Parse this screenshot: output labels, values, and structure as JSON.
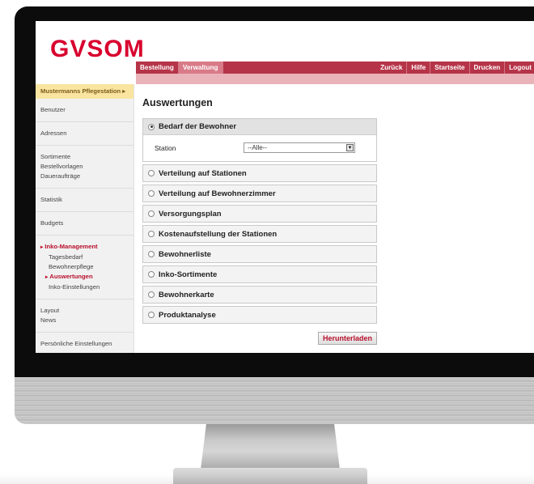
{
  "logo": {
    "text": "GVSOM",
    "color": "#d8002e"
  },
  "nav": {
    "left": [
      "Bestellung",
      "Verwaltung"
    ],
    "active": "Verwaltung",
    "right": [
      "Zurück",
      "Hilfe",
      "Startseite",
      "Drucken",
      "Logout"
    ]
  },
  "sidebar": {
    "station": "Mustermanns Pflegestation",
    "groups": [
      [
        "Benutzer"
      ],
      [
        "Adressen"
      ],
      [
        "Sortimente",
        "Bestellvorlagen",
        "Daueraufträge"
      ],
      [
        "Statistik"
      ],
      [
        "Budgets"
      ],
      [
        "Layout",
        "News"
      ],
      [
        "Persönliche Einstellungen"
      ]
    ],
    "inko": {
      "title": "Inko-Management",
      "items": [
        "Tagesbedarf",
        "Bewohnerpflege",
        "Auswertungen",
        "Inko-Einstellungen"
      ],
      "active": "Auswertungen"
    }
  },
  "main": {
    "title": "Auswertungen",
    "panels": [
      "Bedarf der Bewohner",
      "Verteilung auf Stationen",
      "Verteilung auf Bewohnerzimmer",
      "Versorgungsplan",
      "Kostenaufstellung der Stationen",
      "Bewohnerliste",
      "Inko-Sortimente",
      "Bewohnerkarte",
      "Produktanalyse"
    ],
    "open_panel": "Bedarf der Bewohner",
    "station_label": "Station",
    "station_value": "--Alle--",
    "download_label": "Herunterladen"
  },
  "colors": {
    "brand_red": "#b63448",
    "pink_band": "#eab3ba",
    "active_tab": "#d97a88",
    "station_highlight": "#f9e5a0"
  },
  "icons": {
    "dropdown": "chevron-down-icon",
    "sidebar_arrow": "triangle-right-icon"
  }
}
